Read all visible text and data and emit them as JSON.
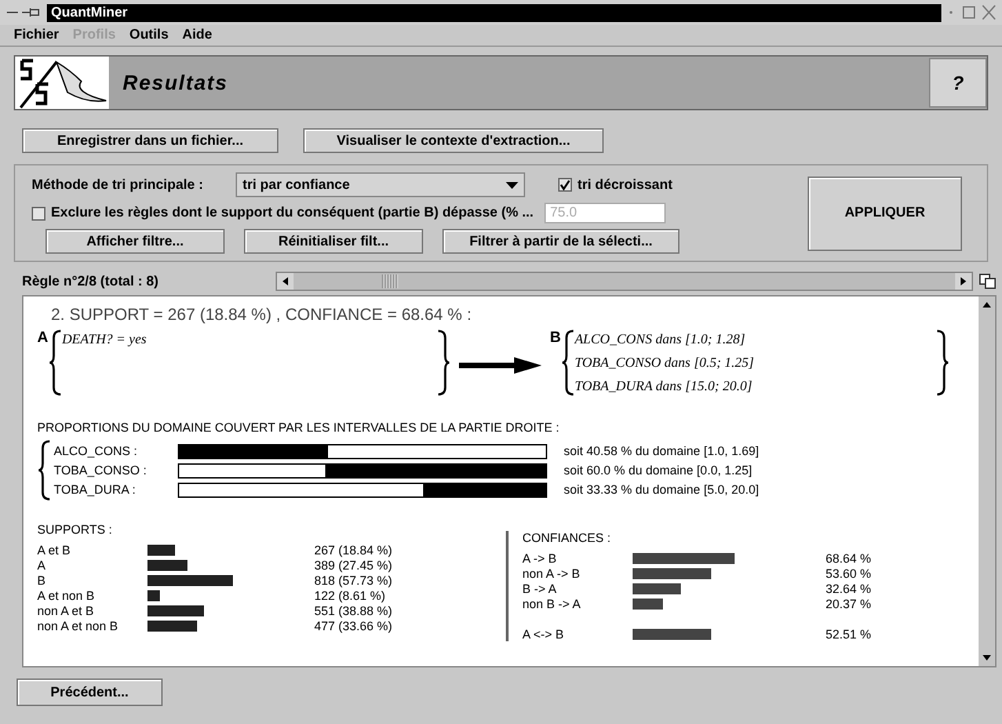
{
  "window": {
    "title": "QuantMiner"
  },
  "menu": [
    {
      "label": "Fichier",
      "disabled": false
    },
    {
      "label": "Profils",
      "disabled": true
    },
    {
      "label": "Outils",
      "disabled": false
    },
    {
      "label": "Aide",
      "disabled": false
    }
  ],
  "header": {
    "title": "Resultats",
    "help": "?"
  },
  "actions": [
    "Enregistrer dans un fichier...",
    "Visualiser le contexte d'extraction..."
  ],
  "filters": {
    "sort_label": "Méthode de tri principale :",
    "sort_value": "tri par confiance",
    "descending": {
      "label": "tri décroissant",
      "checked": true
    },
    "exclude": {
      "label": "Exclure les règles dont le support du conséquent (partie B) dépasse (% ...",
      "checked": false,
      "value": "75.0",
      "disabled": true
    },
    "buttons": [
      "Afficher filtre...",
      "Réinitialiser filt...",
      "Filtrer à partir de la sélecti..."
    ],
    "apply": "APPLIQUER"
  },
  "navigator": {
    "label": "Règle n°2/8 (total : 8)"
  },
  "rule": {
    "heading": "2. SUPPORT = 267 (18.84 %) , CONFIANCE = 68.64 % :",
    "a_label": "A",
    "antecedent": [
      "DEATH? = yes"
    ],
    "b_label": "B",
    "consequent": [
      "ALCO_CONS dans [1.0; 1.28]",
      "TOBA_CONSO dans [0.5; 1.25]",
      "TOBA_DURA dans [15.0; 20.0]"
    ]
  },
  "proportions": {
    "title": "PROPORTIONS DU DOMAINE COUVERT PAR LES INTERVALLES DE LA PARTIE DROITE :",
    "rows": [
      {
        "name": "ALCO_CONS :",
        "level": 0.4058,
        "kind": "start",
        "reading": "soit 40.58 % du domaine [1.0, 1.69]"
      },
      {
        "name": "TOBA_CONSO :",
        "level": 0.6,
        "kind": "end",
        "reading": "soit 60.0 % du domaine [0.0, 1.25]"
      },
      {
        "name": "TOBA_DURA :",
        "level": 0.3333,
        "kind": "end",
        "reading": "soit 33.33 % du domaine [5.0, 20.0]"
      }
    ]
  },
  "supports": {
    "title": "SUPPORTS :",
    "rows": [
      {
        "label": "A et B",
        "reading": "267 (18.84 %)"
      },
      {
        "label": "A",
        "reading": "389 (27.45 %)"
      },
      {
        "label": "B",
        "reading": "818 (57.73 %)"
      },
      {
        "label": "A et non B",
        "reading": "122 (8.61 %)"
      },
      {
        "label": "non A et B",
        "reading": "551 (38.88 %)"
      },
      {
        "label": "non A et non B",
        "reading": "477 (33.66 %)"
      }
    ]
  },
  "confidences": {
    "title": "CONFIANCES :",
    "rows": [
      {
        "label": "A -> B",
        "reading": "68.64 %"
      },
      {
        "label": "non A -> B",
        "reading": "53.60 %"
      },
      {
        "label": "B -> A",
        "reading": "32.64 %"
      },
      {
        "label": "non B -> A",
        "reading": "20.37 %"
      }
    ],
    "equivalence": {
      "label": "A <-> B",
      "reading": "52.51 %"
    }
  },
  "back_button": "Précédent..."
}
